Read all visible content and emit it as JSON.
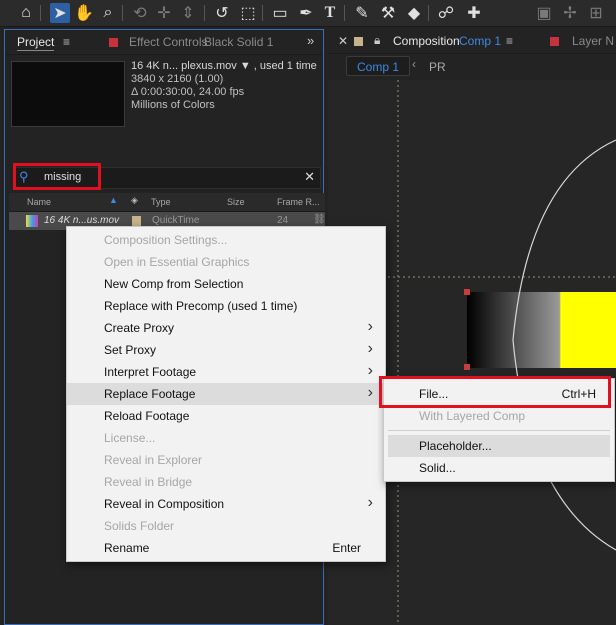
{
  "toolbar": {
    "icons": [
      "home-icon",
      "selection-tool-icon",
      "hand-tool-icon",
      "zoom-tool-icon",
      "orbit-camera-icon",
      "pan-camera-icon",
      "dolly-camera-icon",
      "rotate-tool-icon",
      "anchor-point-tool-icon",
      "rectangle-tool-icon",
      "pen-tool-icon",
      "type-tool-icon",
      "brush-tool-icon",
      "clone-stamp-icon",
      "eraser-icon",
      "roto-brush-icon",
      "puppet-pin-icon"
    ]
  },
  "project_panel": {
    "tab_label": "Project",
    "effect_controls_label": "Effect Controls",
    "effect_controls_target": "Black Solid 1",
    "footage_name": "16 4K n... plexus.mov ▼ , used 1 time",
    "footage_resolution": "3840 x 2160 (1.00)",
    "footage_duration": "Δ 0:00:30:00, 24.00 fps",
    "footage_colors": "Millions of Colors",
    "search_value": "missing",
    "columns": {
      "name": "Name",
      "type": "Type",
      "size": "Size",
      "frame_rate": "Frame R..."
    },
    "row": {
      "name": "16 4K n...us.mov",
      "type": "QuickTime",
      "frame_rate": "24"
    }
  },
  "comp_panel": {
    "tab_prefix": "Composition",
    "comp_name": "Comp 1",
    "layer_tab": "Layer N",
    "breadcrumb_active": "Comp 1",
    "breadcrumb_next": "PR",
    "menu_label": "≡"
  },
  "context_menu": {
    "items": [
      {
        "label": "Composition Settings...",
        "disabled": true
      },
      {
        "label": "Open in Essential Graphics",
        "disabled": true
      },
      {
        "label": "New Comp from Selection",
        "disabled": false
      },
      {
        "label": "Replace with Precomp (used 1 time)",
        "disabled": false
      },
      {
        "label": "Create Proxy",
        "submenu": true
      },
      {
        "label": "Set Proxy",
        "submenu": true
      },
      {
        "label": "Interpret Footage",
        "submenu": true
      },
      {
        "label": "Replace Footage",
        "submenu": true,
        "hover": true
      },
      {
        "label": "Reload Footage",
        "disabled": false
      },
      {
        "label": "License...",
        "disabled": true
      },
      {
        "label": "Reveal in Explorer",
        "disabled": true
      },
      {
        "label": "Reveal in Bridge",
        "disabled": true
      },
      {
        "label": "Reveal in Composition",
        "submenu": true
      },
      {
        "label": "Solids Folder",
        "disabled": true
      },
      {
        "label": "Rename",
        "shortcut": "Enter"
      }
    ]
  },
  "submenu": {
    "items": [
      {
        "label": "File...",
        "shortcut": "Ctrl+H"
      },
      {
        "label": "With Layered Comp",
        "disabled": true
      },
      {
        "label": "Placeholder...",
        "hover": true
      },
      {
        "label": "Solid..."
      }
    ]
  },
  "colors": {
    "accent_blue": "#3d6db5",
    "highlight_red": "#e01020",
    "swatch_red": "#c8323c",
    "swatch_tan": "#c8b48c",
    "gradient_yellow": "#ffff00"
  }
}
